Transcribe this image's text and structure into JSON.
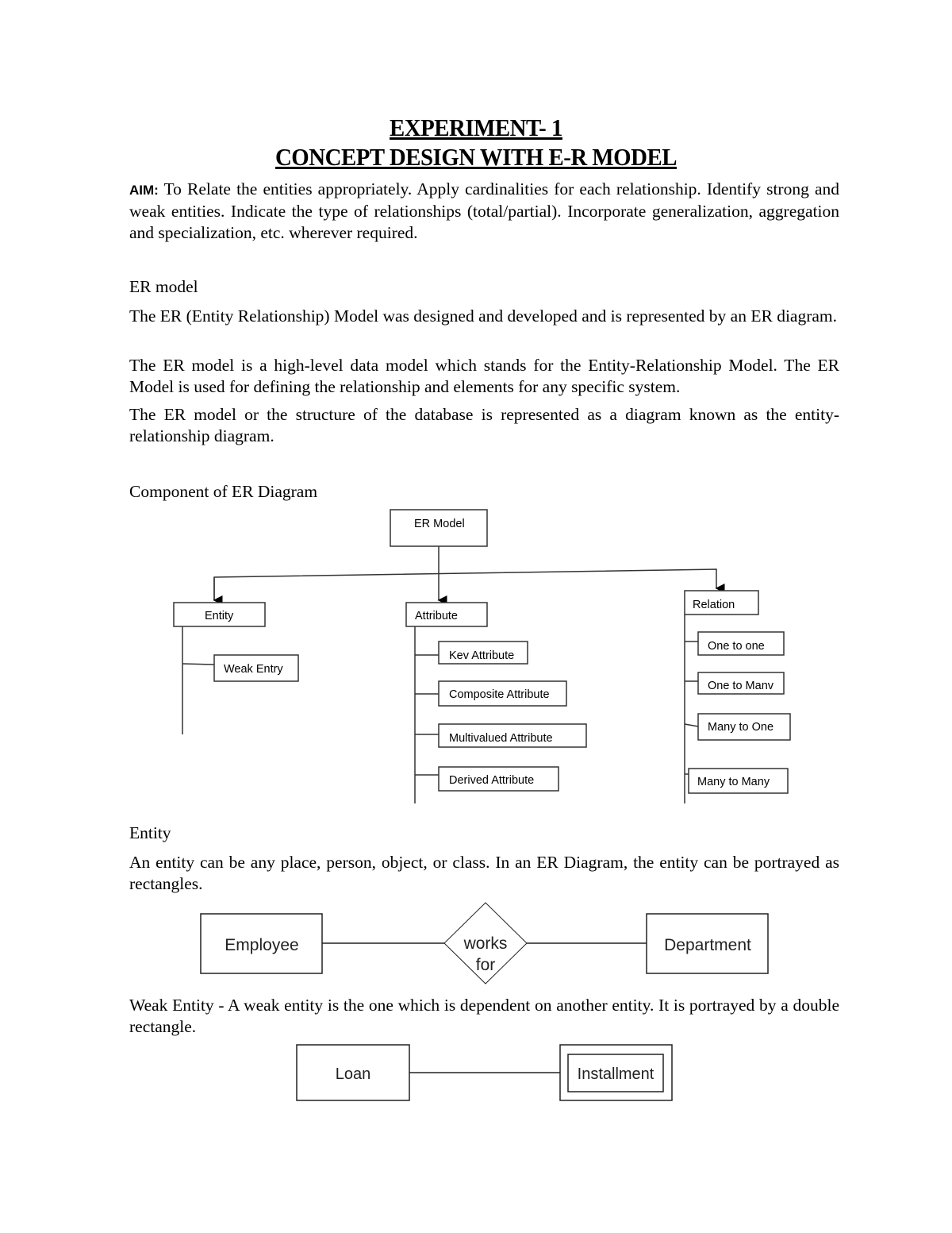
{
  "title": {
    "line1": "EXPERIMENT- 1",
    "line2": "CONCEPT DESIGN WITH E-R MODEL"
  },
  "aim": {
    "label": "AIM:",
    "text": " To Relate the entities appropriately. Apply cardinalities for each relationship. Identify strong and weak entities. Indicate the type of relationships (total/partial). Incorporate generalization, aggregation and specialization, etc. wherever required."
  },
  "er_model": {
    "heading": "ER model",
    "paragraphs": [
      "The ER (Entity Relationship) Model was designed and developed and is represented by an ER diagram.",
      "The ER model is a high-level data model which stands for the Entity-Relationship Model. The ER Model is used for defining the relationship and elements for any specific system.",
      "The ER model or the structure of the database is represented as a diagram known as the entity-relationship diagram."
    ]
  },
  "components": {
    "heading": "Component of ER Diagram",
    "diagram": {
      "root": "ER Model",
      "entity": {
        "label": "Entity",
        "children": [
          "Weak Entry"
        ]
      },
      "attribute": {
        "label": "Attribute",
        "children": [
          "Kev Attribute",
          "Composite Attribute",
          "Multivalued Attribute",
          "Derived Attribute"
        ]
      },
      "relation": {
        "label": "Relation",
        "children": [
          "One to one",
          "One to Manv",
          "Many to One",
          "Many to Many"
        ]
      }
    }
  },
  "entity": {
    "heading": "Entity",
    "text": "An entity can be any place, person, object, or class. In an ER Diagram, the entity can be portrayed as rectangles.",
    "example": {
      "left": "Employee",
      "relationship_line1": "works",
      "relationship_line2": "for",
      "right": "Department"
    }
  },
  "weak_entity": {
    "text": "Weak Entity - A weak entity is the one which is dependent on another entity. It is portrayed by a double rectangle.",
    "example": {
      "left": "Loan",
      "right": "Installment"
    }
  }
}
